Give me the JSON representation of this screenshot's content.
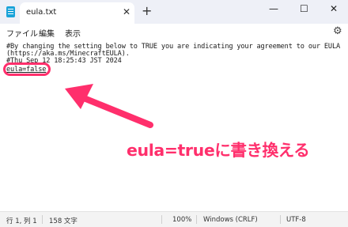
{
  "window": {
    "tab_title": "eula.txt",
    "tab_close": "✕",
    "new_tab": "+",
    "minimize": "—",
    "maximize": "☐",
    "close": "✕"
  },
  "menu": {
    "items": [
      "ファイル",
      "編集",
      "表示"
    ],
    "settings_icon": "⚙"
  },
  "editor": {
    "lines": [
      "#By changing the setting below to TRUE you are indicating your agreement to our EULA",
      "(https://aka.ms/MinecraftEULA).",
      "#Thu Sep 12 18:25:43 JST 2024",
      "eula=false"
    ]
  },
  "annotation": {
    "text": "eula=trueに書き換える",
    "color": "#ff2f6c"
  },
  "status": {
    "position": "行 1, 列 1",
    "chars": "158 文字",
    "zoom": "100%",
    "line_ending": "Windows (CRLF)",
    "encoding": "UTF-8"
  }
}
